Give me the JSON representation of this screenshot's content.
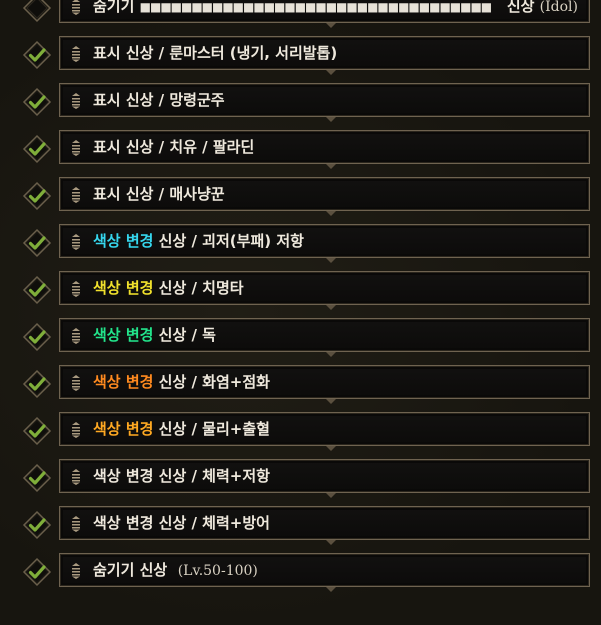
{
  "colors": {
    "cyan": "#36d7ee",
    "yellow": "#f1e12c",
    "green": "#22e48b",
    "orange": "#ff8a1f",
    "gold": "#ffa922",
    "check_green": "#7fae3a"
  },
  "filters": [
    {
      "checked": false,
      "name": "숨기기",
      "blocks": "■■■■■■■■■■■■■■■■■■■■■■■■■■■■■■■■■■",
      "tail": "신상",
      "serif": "(Idol)"
    },
    {
      "checked": true,
      "prefix": "표시 신상",
      "rest": " / 룬마스터 (냉기, 서리발톱)"
    },
    {
      "checked": true,
      "prefix": "표시 신상",
      "rest": " / 망령군주"
    },
    {
      "checked": true,
      "prefix": "표시 신상",
      "rest": " / 치유 / 팔라딘"
    },
    {
      "checked": true,
      "prefix": "표시 신상",
      "rest": " / 매사냥꾼"
    },
    {
      "checked": true,
      "colored": "색상 변경",
      "color": "cyan",
      "rest": " 신상 / 괴저(부패) 저항"
    },
    {
      "checked": true,
      "colored": "색상 변경",
      "color": "yellow",
      "rest": " 신상 / 치명타"
    },
    {
      "checked": true,
      "colored": "색상 변경",
      "color": "green",
      "rest": " 신상 / 독"
    },
    {
      "checked": true,
      "colored": "색상 변경",
      "color": "orange",
      "rest": " 신상 / 화염+점화"
    },
    {
      "checked": true,
      "colored": "색상 변경",
      "color": "gold",
      "rest": " 신상 / 물리+출혈"
    },
    {
      "checked": true,
      "prefix": "색상 변경 신상",
      "rest": " / 체력+저항"
    },
    {
      "checked": true,
      "prefix": "색상 변경 신상",
      "rest": " / 체력+방어"
    },
    {
      "checked": true,
      "prefix": "숨기기 신상",
      "serif": "(Lv.50-100)"
    }
  ]
}
